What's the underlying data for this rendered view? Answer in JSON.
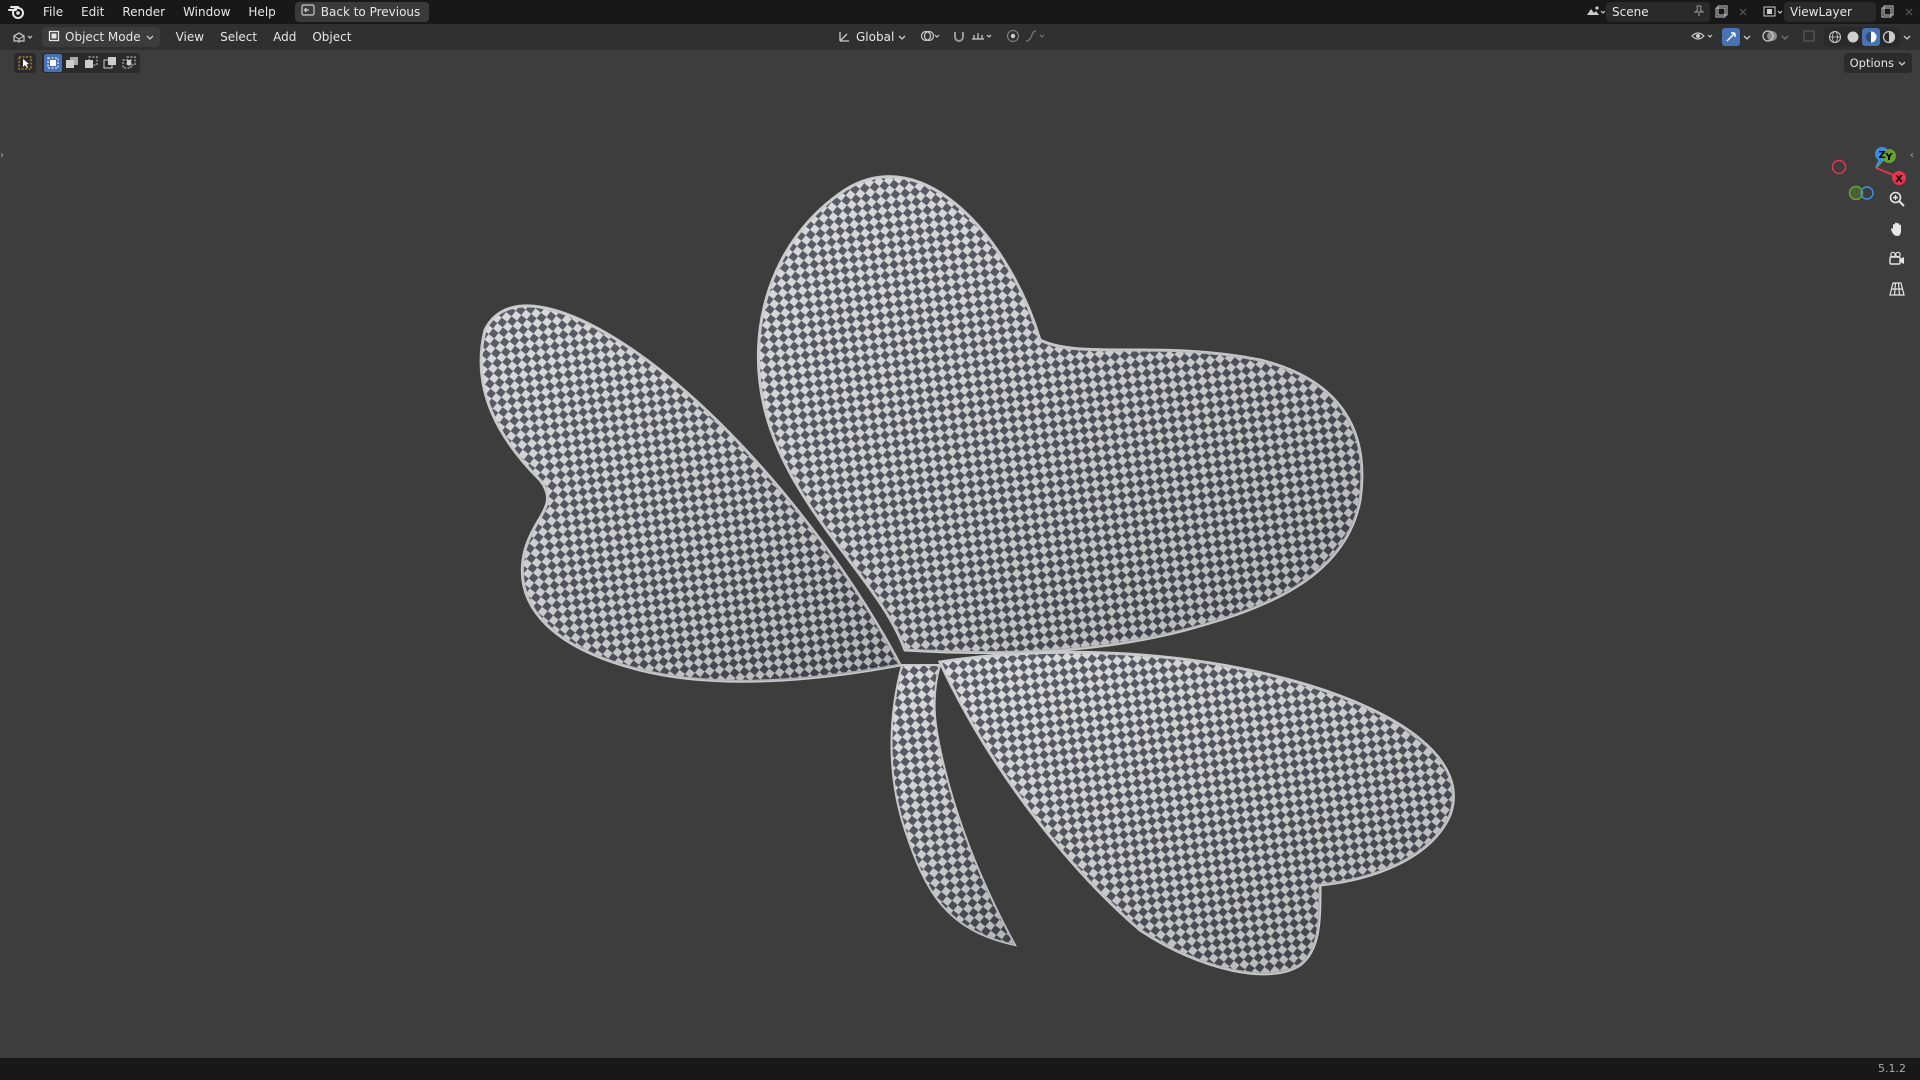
{
  "topbar": {
    "menus": [
      "File",
      "Edit",
      "Render",
      "Window",
      "Help"
    ],
    "back_label": "Back to Previous",
    "scene_name": "Scene",
    "view_layer_name": "ViewLayer"
  },
  "header": {
    "mode_label": "Object Mode",
    "menus": [
      "View",
      "Select",
      "Add",
      "Object"
    ],
    "orientation_label": "Global",
    "options_label": "Options"
  },
  "gizmo": {
    "z_label": "Z",
    "y_label": "Y",
    "x_label": "X",
    "colors": {
      "x": "#e5344e",
      "y": "#6ba033",
      "z": "#3b8ee5"
    }
  },
  "viewport": {
    "background": "#3d3d3d",
    "object": "shamrock",
    "checker_light": "#d6d6d8",
    "checker_dark": "#4a4a55"
  },
  "status": {
    "version": "5.1.2"
  }
}
